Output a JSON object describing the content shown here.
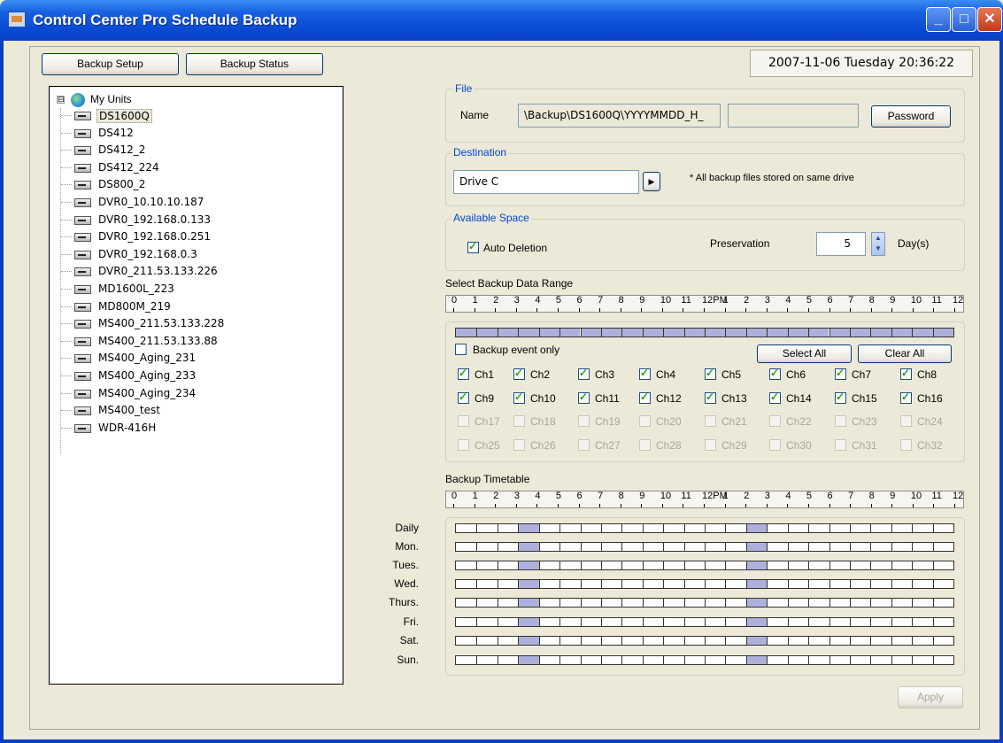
{
  "window": {
    "title": "Control Center Pro Schedule Backup",
    "controls": [
      "minimize-icon",
      "maximize-icon",
      "close-icon"
    ]
  },
  "toolbar": {
    "backup_setup": "Backup Setup",
    "backup_status": "Backup Status",
    "datetime": "2007-11-06  Tuesday  20:36:22"
  },
  "tree": {
    "root": "My Units",
    "expander": "⊟",
    "selected": "DS1600Q",
    "items": [
      "DS1600Q",
      "DS412",
      "DS412_2",
      "DS412_224",
      "DS800_2",
      "DVR0_10.10.10.187",
      "DVR0_192.168.0.133",
      "DVR0_192.168.0.251",
      "DVR0_192.168.0.3",
      "DVR0_211.53.133.226",
      "MD1600L_223",
      "MD800M_219",
      "MS400_211.53.133.228",
      "MS400_211.53.133.88",
      "MS400_Aging_231",
      "MS400_Aging_233",
      "MS400_Aging_234",
      "MS400_test",
      "WDR-416H"
    ]
  },
  "file": {
    "title": "File",
    "name_label": "Name",
    "name_value": "\\Backup\\DS1600Q\\YYYYMMDD_H_",
    "extra_value": "",
    "password_label": "Password"
  },
  "destination": {
    "title": "Destination",
    "drive": "Drive C",
    "arrow": "▶",
    "note": "* All backup files stored on same drive"
  },
  "space": {
    "title": "Available Space",
    "auto_deletion_label": "Auto Deletion",
    "auto_deletion_checked": true,
    "preservation_label": "Preservation",
    "preservation_value": "5",
    "unit": "Day(s)"
  },
  "range": {
    "title": "Select Backup Data Range",
    "hour_labels": [
      "0",
      "1",
      "2",
      "3",
      "4",
      "5",
      "6",
      "7",
      "8",
      "9",
      "10",
      "11",
      "12PM",
      "1",
      "2",
      "3",
      "4",
      "5",
      "6",
      "7",
      "8",
      "9",
      "10",
      "11",
      "12"
    ],
    "backup_event_only_label": "Backup event only",
    "backup_event_only": false,
    "select_all": "Select All",
    "clear_all": "Clear All",
    "channels": [
      {
        "label": "Ch1",
        "checked": true,
        "enabled": true
      },
      {
        "label": "Ch2",
        "checked": true,
        "enabled": true
      },
      {
        "label": "Ch3",
        "checked": true,
        "enabled": true
      },
      {
        "label": "Ch4",
        "checked": true,
        "enabled": true
      },
      {
        "label": "Ch5",
        "checked": true,
        "enabled": true
      },
      {
        "label": "Ch6",
        "checked": true,
        "enabled": true
      },
      {
        "label": "Ch7",
        "checked": true,
        "enabled": true
      },
      {
        "label": "Ch8",
        "checked": true,
        "enabled": true
      },
      {
        "label": "Ch9",
        "checked": true,
        "enabled": true
      },
      {
        "label": "Ch10",
        "checked": true,
        "enabled": true
      },
      {
        "label": "Ch11",
        "checked": true,
        "enabled": true
      },
      {
        "label": "Ch12",
        "checked": true,
        "enabled": true
      },
      {
        "label": "Ch13",
        "checked": true,
        "enabled": true
      },
      {
        "label": "Ch14",
        "checked": true,
        "enabled": true
      },
      {
        "label": "Ch15",
        "checked": true,
        "enabled": true
      },
      {
        "label": "Ch16",
        "checked": true,
        "enabled": true
      },
      {
        "label": "Ch17",
        "checked": false,
        "enabled": false
      },
      {
        "label": "Ch18",
        "checked": false,
        "enabled": false
      },
      {
        "label": "Ch19",
        "checked": false,
        "enabled": false
      },
      {
        "label": "Ch20",
        "checked": false,
        "enabled": false
      },
      {
        "label": "Ch21",
        "checked": false,
        "enabled": false
      },
      {
        "label": "Ch22",
        "checked": false,
        "enabled": false
      },
      {
        "label": "Ch23",
        "checked": false,
        "enabled": false
      },
      {
        "label": "Ch24",
        "checked": false,
        "enabled": false
      },
      {
        "label": "Ch25",
        "checked": false,
        "enabled": false
      },
      {
        "label": "Ch26",
        "checked": false,
        "enabled": false
      },
      {
        "label": "Ch27",
        "checked": false,
        "enabled": false
      },
      {
        "label": "Ch28",
        "checked": false,
        "enabled": false
      },
      {
        "label": "Ch29",
        "checked": false,
        "enabled": false
      },
      {
        "label": "Ch30",
        "checked": false,
        "enabled": false
      },
      {
        "label": "Ch31",
        "checked": false,
        "enabled": false
      },
      {
        "label": "Ch32",
        "checked": false,
        "enabled": false
      }
    ]
  },
  "timetable": {
    "title": "Backup Timetable",
    "days": [
      "Daily",
      "Mon.",
      "Tues.",
      "Wed.",
      "Thurs.",
      "Fri.",
      "Sat.",
      "Sun."
    ],
    "scheduled_hours": [
      3,
      14
    ]
  },
  "apply_label": "Apply",
  "colors": {
    "selected_slot": "#aeb0dc",
    "group_title": "#0046d5",
    "title_bar": "#0a4bd6"
  }
}
